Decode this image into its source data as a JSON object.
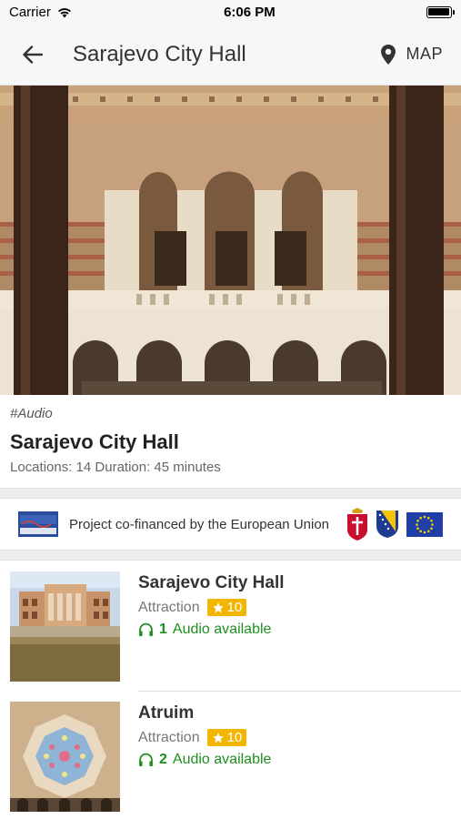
{
  "status_bar": {
    "carrier": "Carrier",
    "time": "6:06 PM"
  },
  "nav": {
    "title": "Sarajevo City Hall",
    "map_label": "MAP"
  },
  "hero": {
    "image": "sarajevo-city-hall-atrium"
  },
  "intro": {
    "tag": "#Audio",
    "title": "Sarajevo City Hall",
    "meta": "Locations: 14 Duration: 45 minutes"
  },
  "eu_banner": {
    "text": "Project co-financed by the European Union"
  },
  "items": [
    {
      "title": "Sarajevo City Hall",
      "category": "Attraction",
      "rating": "10",
      "audio_count": "1",
      "audio_label": "Audio available"
    },
    {
      "title": "Atruim",
      "category": "Attraction",
      "rating": "10",
      "audio_count": "2",
      "audio_label": "Audio available"
    }
  ],
  "colors": {
    "rating_bg": "#f2b600",
    "audio_green": "#1f8f1f"
  }
}
